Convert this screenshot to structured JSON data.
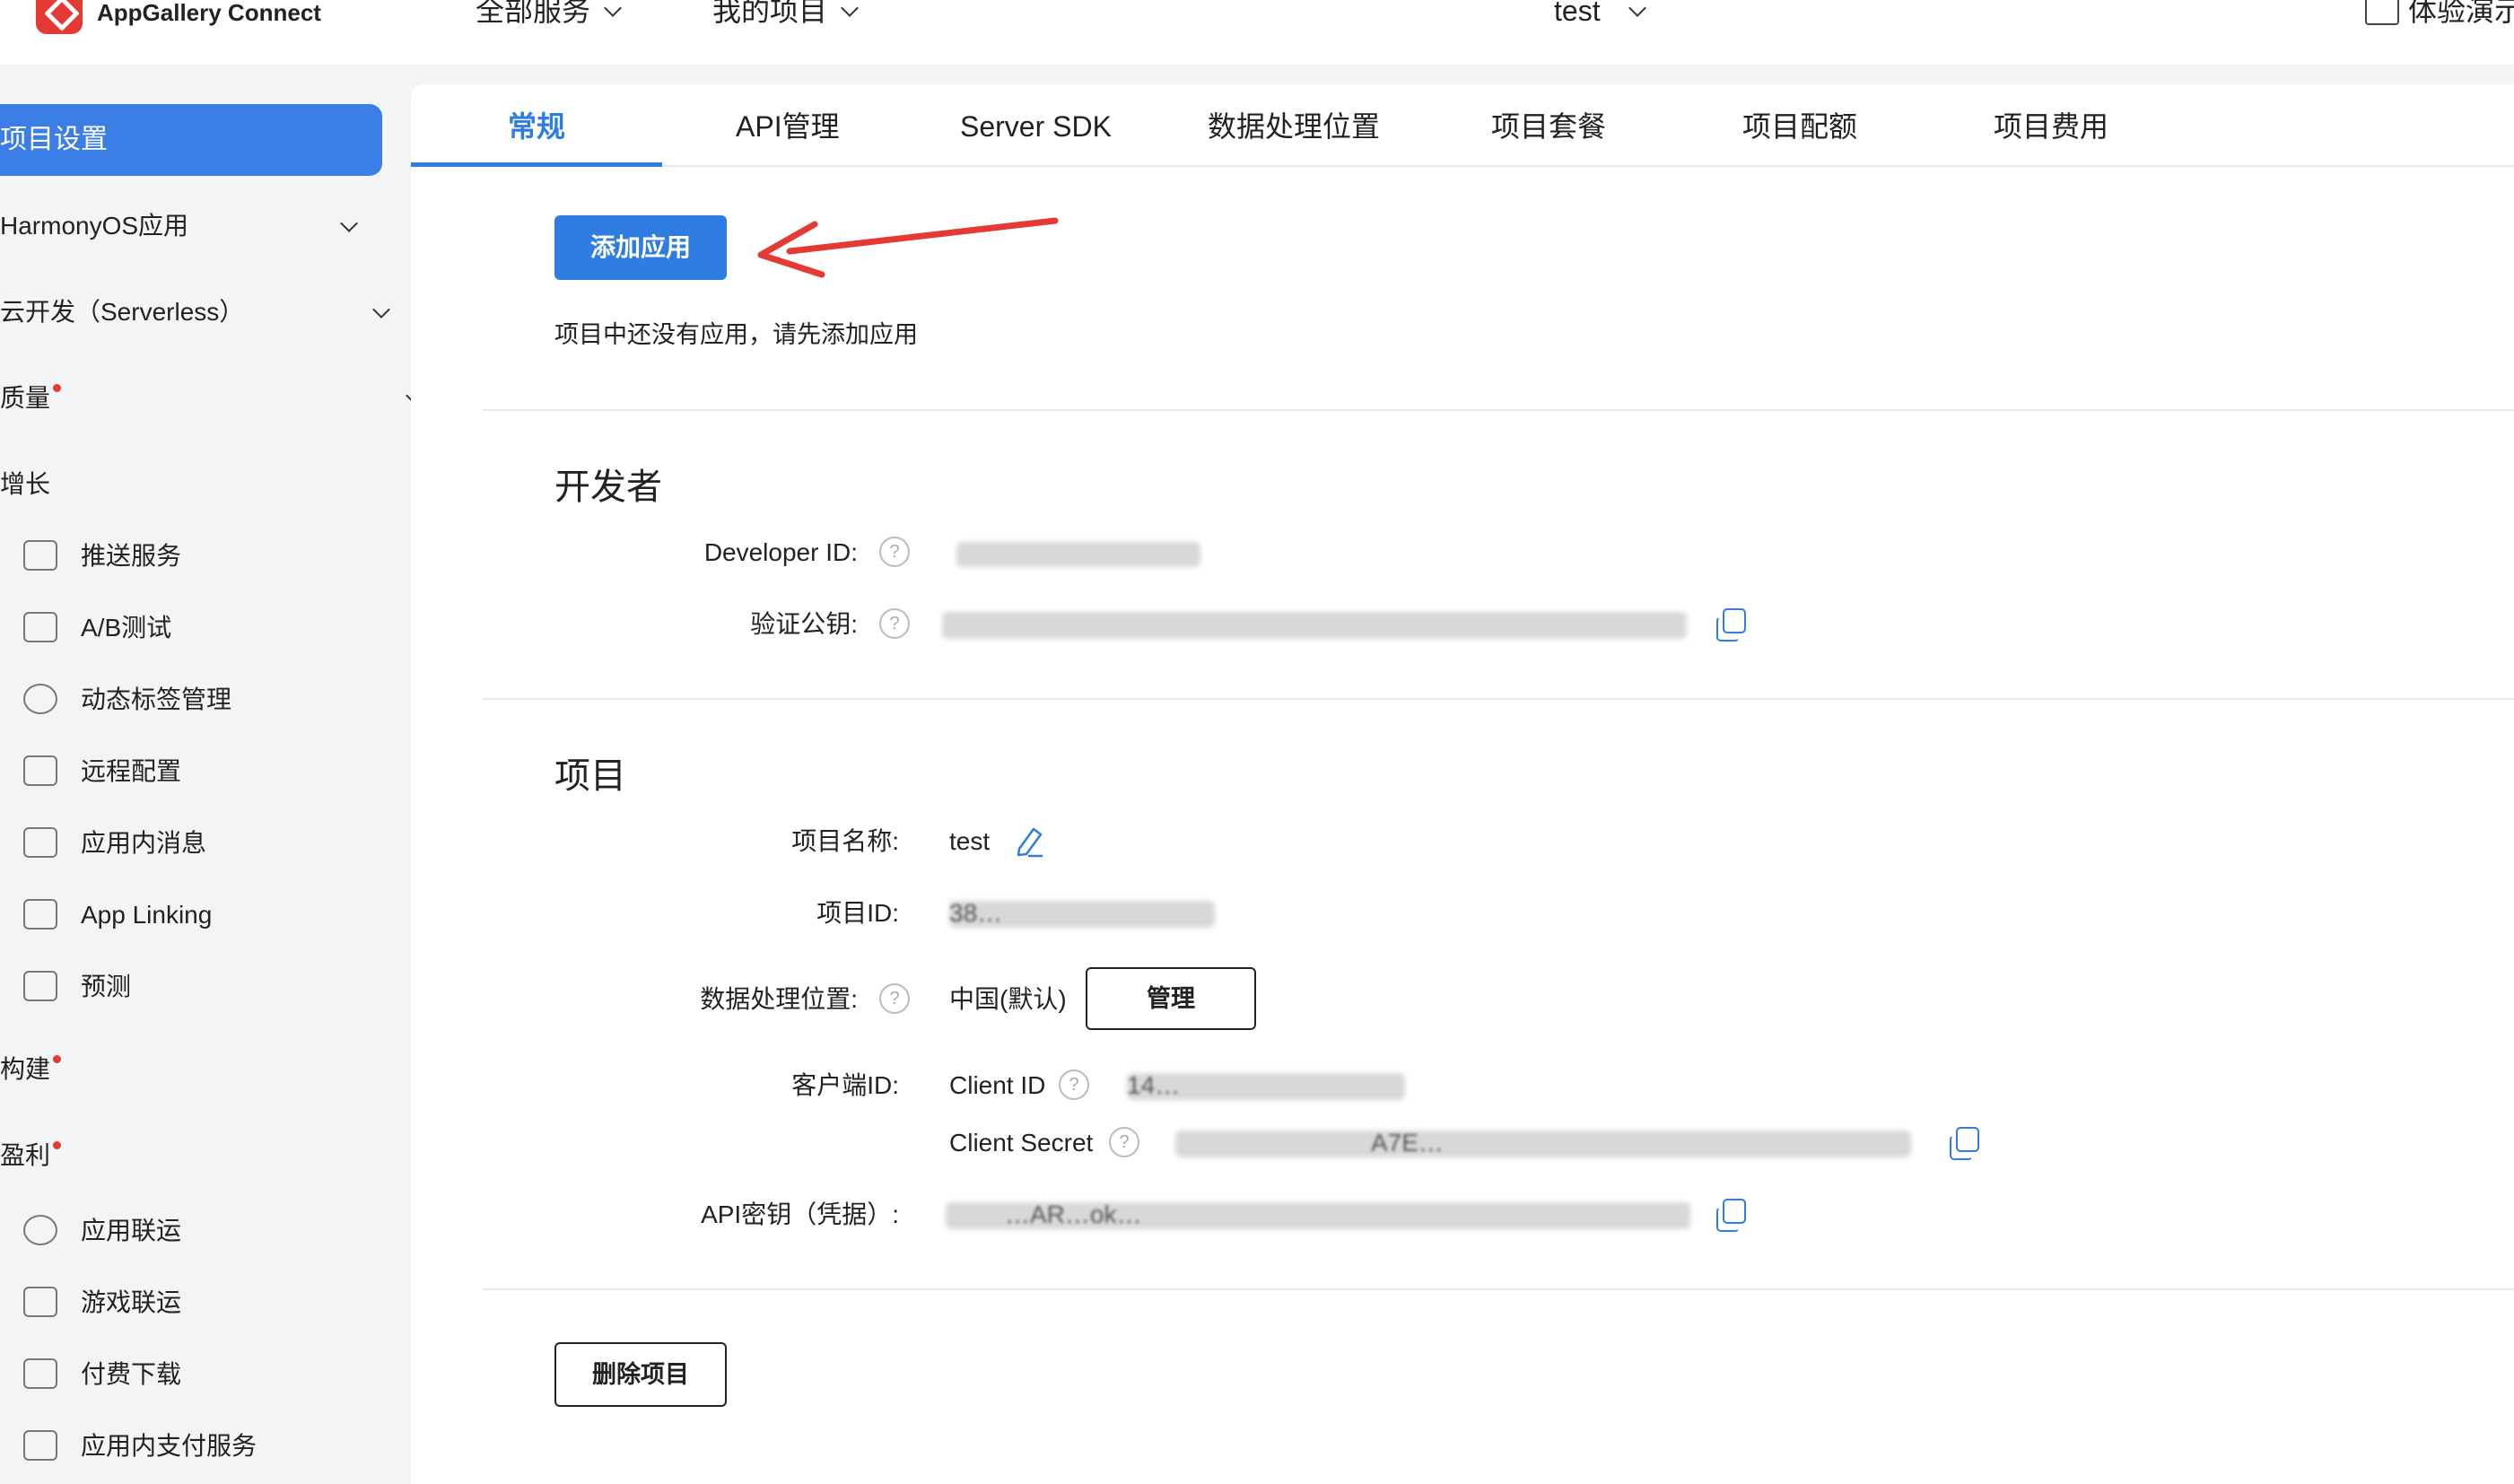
{
  "header": {
    "brand": "AppGallery Connect",
    "nav_all_services": "全部服务",
    "nav_my_projects": "我的项目",
    "project_selector": "test",
    "demo": "体验演示"
  },
  "sidebar": {
    "active_item": "项目设置",
    "groups": [
      {
        "label": "HarmonyOS应用",
        "dot": false,
        "expanded": false
      },
      {
        "label": "云开发（Serverless）",
        "dot": false,
        "expanded": false
      },
      {
        "label": "质量",
        "dot": true,
        "expanded": false
      },
      {
        "label": "增长",
        "dot": false,
        "expanded": true
      },
      {
        "label": "构建",
        "dot": true,
        "expanded": false
      },
      {
        "label": "盈利",
        "dot": true,
        "expanded": true
      }
    ],
    "growth_items": [
      {
        "label": "推送服务",
        "icon": "rocket-icon"
      },
      {
        "label": "A/B测试",
        "icon": "ab-test-icon"
      },
      {
        "label": "动态标签管理",
        "icon": "tag-network-icon"
      },
      {
        "label": "远程配置",
        "icon": "remote-config-icon"
      },
      {
        "label": "应用内消息",
        "icon": "message-icon"
      },
      {
        "label": "App Linking",
        "icon": "link-icon"
      },
      {
        "label": "预测",
        "icon": "predict-chart-icon"
      }
    ],
    "monetize_items": [
      {
        "label": "应用联运",
        "icon": "app-network-icon"
      },
      {
        "label": "游戏联运",
        "icon": "game-chart-icon"
      },
      {
        "label": "付费下载",
        "icon": "paid-download-icon"
      },
      {
        "label": "应用内支付服务",
        "icon": "in-app-payment-icon"
      }
    ]
  },
  "tabs": [
    {
      "label": "常规",
      "active": true
    },
    {
      "label": "API管理",
      "active": false
    },
    {
      "label": "Server SDK",
      "active": false
    },
    {
      "label": "数据处理位置",
      "active": false
    },
    {
      "label": "项目套餐",
      "active": false
    },
    {
      "label": "项目配额",
      "active": false
    },
    {
      "label": "项目费用",
      "active": false
    }
  ],
  "apps": {
    "add_button": "添加应用",
    "empty_text": "项目中还没有应用，请先添加应用"
  },
  "developer": {
    "title": "开发者",
    "developer_id_label": "Developer ID:",
    "public_key_label": "验证公钥:"
  },
  "project": {
    "title": "项目",
    "name_label": "项目名称:",
    "name_value": "test",
    "id_label": "项目ID:",
    "id_value_partial": "38…",
    "location_label": "数据处理位置:",
    "location_value": "中国(默认)",
    "manage_button": "管理",
    "client_id_group_label": "客户端ID:",
    "client_id_label": "Client ID",
    "client_id_value_partial": "14…",
    "client_secret_label": "Client Secret",
    "client_secret_value_partial": "A7E…",
    "api_key_label": "API密钥（凭据）:",
    "api_key_value_partial": "…AR…ok…",
    "delete_button": "删除项目"
  },
  "colors": {
    "accent": "#2f7de1",
    "sidebar_active": "#3a7ee6",
    "badge_dot": "#e53935",
    "annotation_arrow": "#e53935"
  }
}
